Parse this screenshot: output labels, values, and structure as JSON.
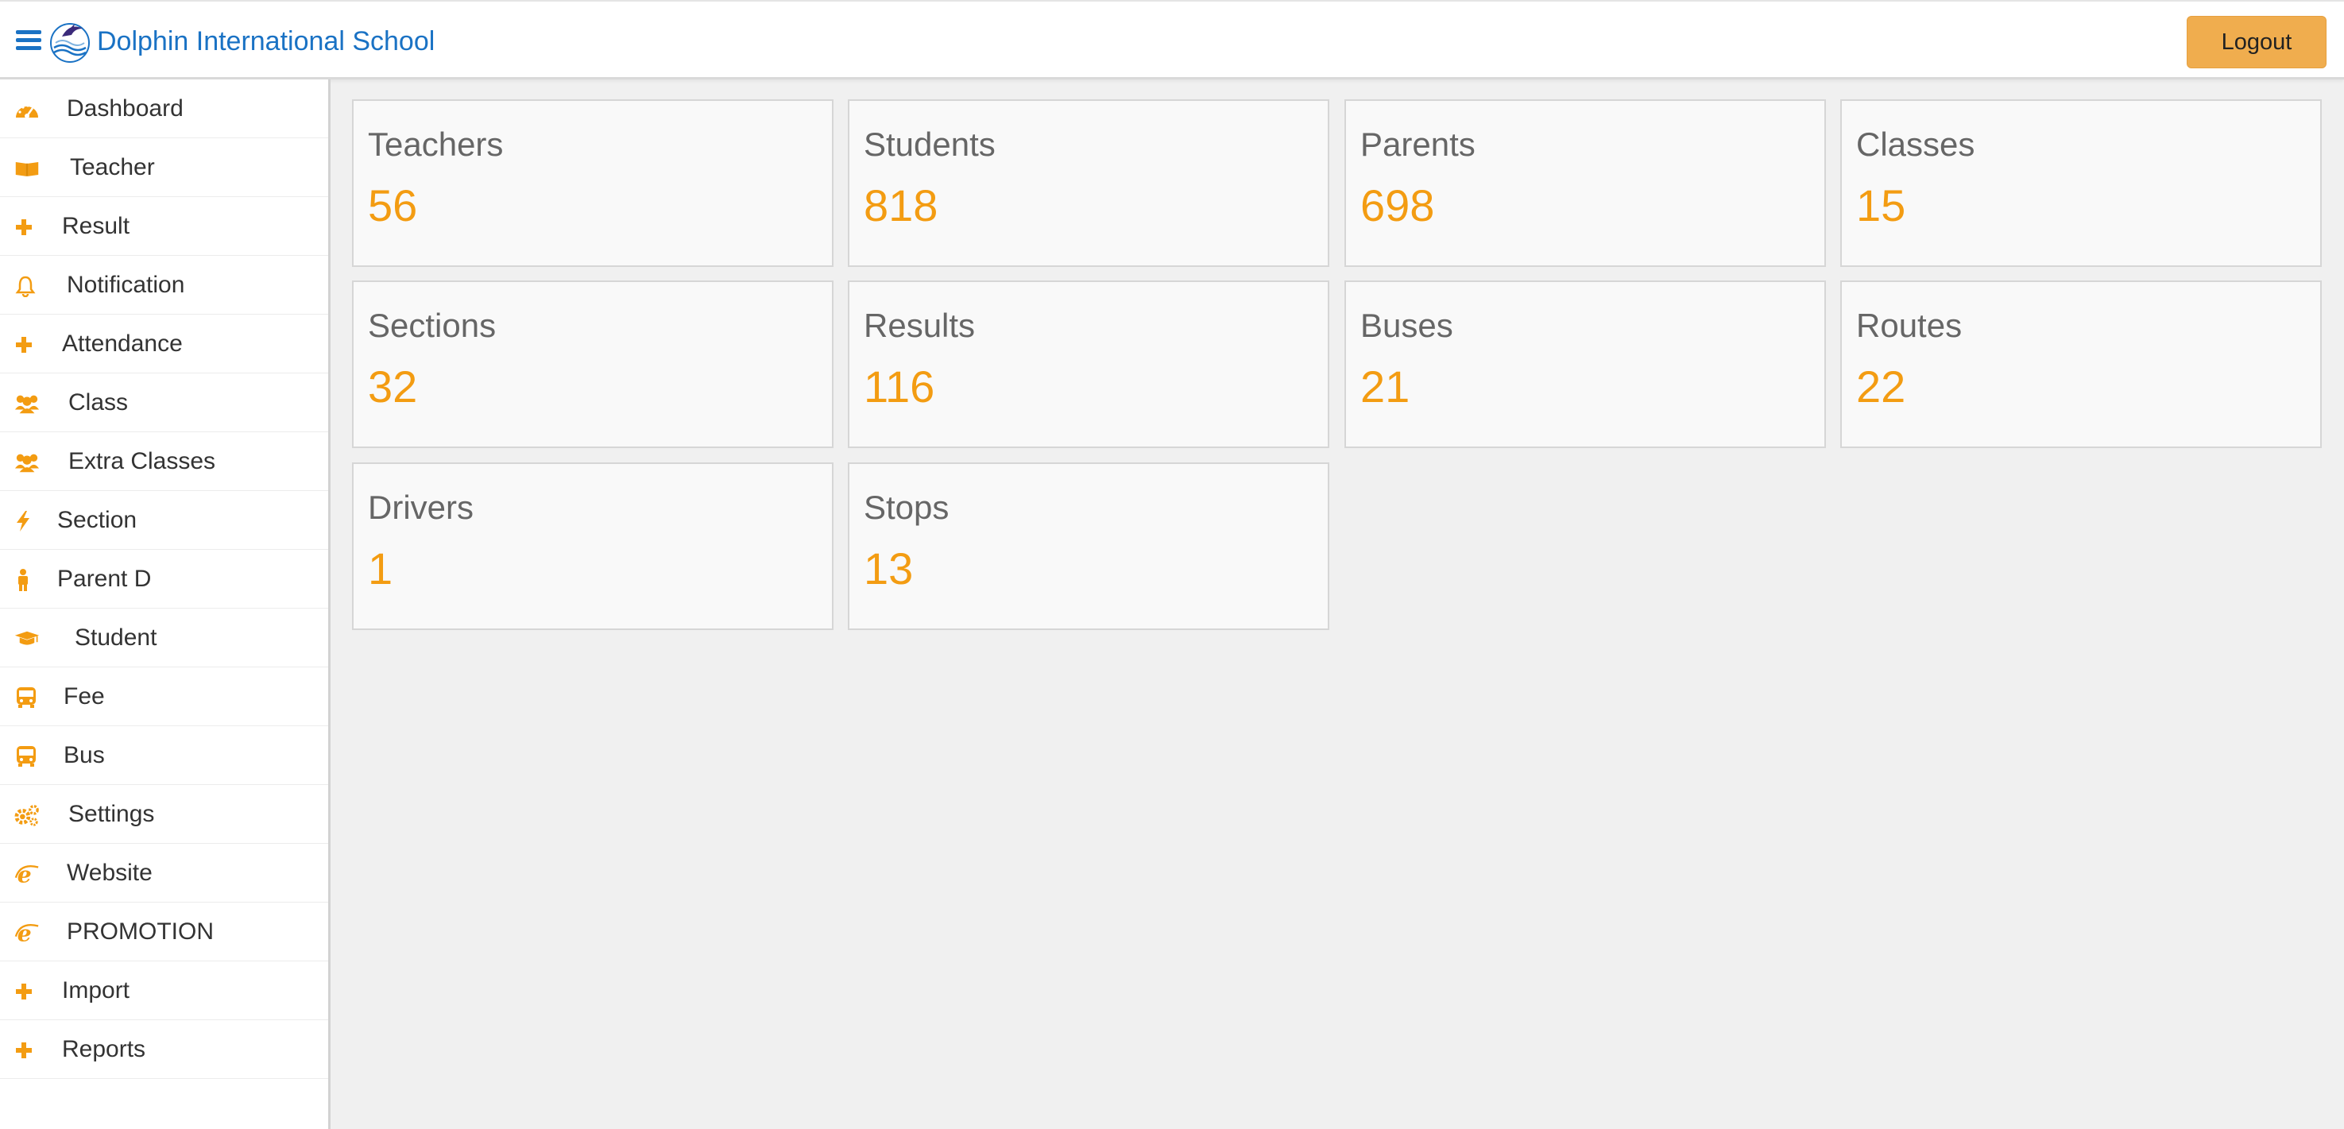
{
  "header": {
    "school_name": "Dolphin International School",
    "logout_label": "Logout",
    "brand_color": "#1a72c4",
    "accent_color": "#f0ad4e"
  },
  "sidebar": {
    "icon_color": "#f39c12",
    "items": [
      {
        "label": "Dashboard",
        "icon": "dashboard-icon"
      },
      {
        "label": "Teacher",
        "icon": "book-open-icon"
      },
      {
        "label": "Result",
        "icon": "plus-icon"
      },
      {
        "label": "Notification",
        "icon": "bell-icon"
      },
      {
        "label": "Attendance",
        "icon": "plus-icon"
      },
      {
        "label": "Class",
        "icon": "users-icon"
      },
      {
        "label": "Extra Classes",
        "icon": "users-icon"
      },
      {
        "label": "Section",
        "icon": "bolt-icon"
      },
      {
        "label": "Parent D",
        "icon": "person-icon"
      },
      {
        "label": "Student",
        "icon": "graduation-cap-icon"
      },
      {
        "label": "Fee",
        "icon": "bus-icon"
      },
      {
        "label": "Bus",
        "icon": "bus-icon"
      },
      {
        "label": "Settings",
        "icon": "gears-icon"
      },
      {
        "label": "Website",
        "icon": "internet-explorer-icon"
      },
      {
        "label": "PROMOTION",
        "icon": "internet-explorer-icon"
      },
      {
        "label": "Import",
        "icon": "plus-icon"
      },
      {
        "label": "Reports",
        "icon": "plus-icon"
      }
    ]
  },
  "stats": [
    {
      "title": "Teachers",
      "value": "56"
    },
    {
      "title": "Students",
      "value": "818"
    },
    {
      "title": "Parents",
      "value": "698"
    },
    {
      "title": "Classes",
      "value": "15"
    },
    {
      "title": "Sections",
      "value": "32"
    },
    {
      "title": "Results",
      "value": "116"
    },
    {
      "title": "Buses",
      "value": "21"
    },
    {
      "title": "Routes",
      "value": "22"
    },
    {
      "title": "Drivers",
      "value": "1"
    },
    {
      "title": "Stops",
      "value": "13"
    }
  ]
}
